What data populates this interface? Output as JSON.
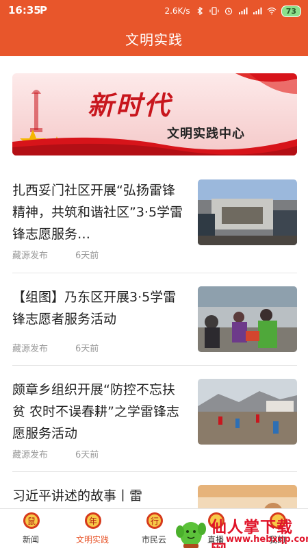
{
  "status_bar": {
    "time": "16:35",
    "app_icon": "P",
    "network_speed": "2.6K/s",
    "battery": "73"
  },
  "header": {
    "title": "文明实践"
  },
  "banner": {
    "main_text": "新时代",
    "sub_text": "文明实践中心"
  },
  "news": [
    {
      "headline": "扎西妥门社区开展“弘扬雷锋精神，共筑和谐社区”3·5学雷锋志愿服务…",
      "source": "藏源发布",
      "date": "6天前"
    },
    {
      "headline": "【组图】乃东区开展3·5学雷锋志愿者服务活动",
      "source": "藏源发布",
      "date": "6天前"
    },
    {
      "headline": "颇章乡组织开展“防控不忘扶贫 农时不误春耕”之学雷锋志愿服务活动",
      "source": "藏源发布",
      "date": "6天前"
    },
    {
      "headline": "习近平讲述的故事丨雷",
      "source": "",
      "date": ""
    }
  ],
  "bottom_nav": {
    "items": [
      {
        "label": "新闻",
        "icon": "news-icon",
        "active": false
      },
      {
        "label": "文明实践",
        "icon": "civilization-icon",
        "active": true
      },
      {
        "label": "市民云",
        "icon": "citizen-cloud-icon",
        "active": false
      },
      {
        "label": "直播",
        "icon": "live-icon",
        "active": false
      },
      {
        "label": "我的",
        "icon": "profile-icon",
        "active": false
      }
    ]
  },
  "watermark": {
    "text": "仙人掌下载网",
    "url": "www.hebxqp.com"
  },
  "colors": {
    "accent": "#e8562b",
    "meta_text": "#9a9a9a"
  }
}
